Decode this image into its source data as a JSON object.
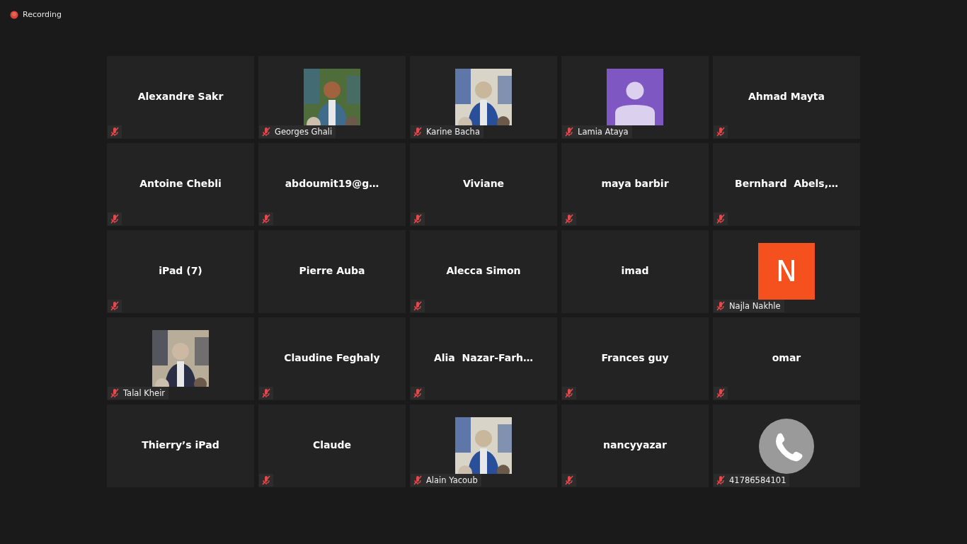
{
  "recording": {
    "label": "Recording"
  },
  "tiles": [
    {
      "kind": "name",
      "name": "Alexandre Sakr",
      "muted": true
    },
    {
      "name": "Georges Ghali",
      "muted": true
    },
    {
      "name": "Karine Bacha",
      "muted": true
    },
    {
      "kind": "avatar",
      "name": "Lamia Ataya",
      "muted": true,
      "color": "#7e57c2"
    },
    {
      "kind": "name",
      "name": "Ahmad Mayta",
      "muted": true
    },
    {
      "kind": "name",
      "name": "Antoine Chebli",
      "muted": true
    },
    {
      "kind": "name",
      "name": "abdoumit19@g…",
      "muted": true
    },
    {
      "kind": "name",
      "name": "Viviane",
      "muted": true
    },
    {
      "kind": "name",
      "name": "maya barbir",
      "muted": true
    },
    {
      "kind": "name",
      "name": "Bernhard  Abels,…",
      "muted": true
    },
    {
      "kind": "name",
      "name": "iPad (7)",
      "muted": true
    },
    {
      "kind": "name",
      "name": "Pierre Auba",
      "muted": false
    },
    {
      "kind": "name",
      "name": "Alecca Simon",
      "muted": true
    },
    {
      "kind": "name",
      "name": "imad",
      "muted": false
    },
    {
      "kind": "initial",
      "name": "Najla Nakhle",
      "initial": "N",
      "muted": true,
      "color": "#f4511e"
    },
    {
      "name": "Talal Kheir",
      "muted": true
    },
    {
      "kind": "name",
      "name": "Claudine Feghaly",
      "muted": true
    },
    {
      "kind": "name",
      "name": "Alia  Nazar-Farh…",
      "muted": true
    },
    {
      "kind": "name",
      "name": "Frances guy",
      "muted": true
    },
    {
      "kind": "name",
      "name": "omar",
      "muted": true
    },
    {
      "kind": "name",
      "name": "Thierry’s iPad",
      "muted": false
    },
    {
      "kind": "name",
      "name": "Claude",
      "muted": true
    },
    {
      "name": "Alain Yacoub",
      "muted": true
    },
    {
      "kind": "name",
      "name": "nancyyazar",
      "muted": true
    },
    {
      "kind": "phone",
      "name": "41786584101",
      "muted": true
    }
  ]
}
